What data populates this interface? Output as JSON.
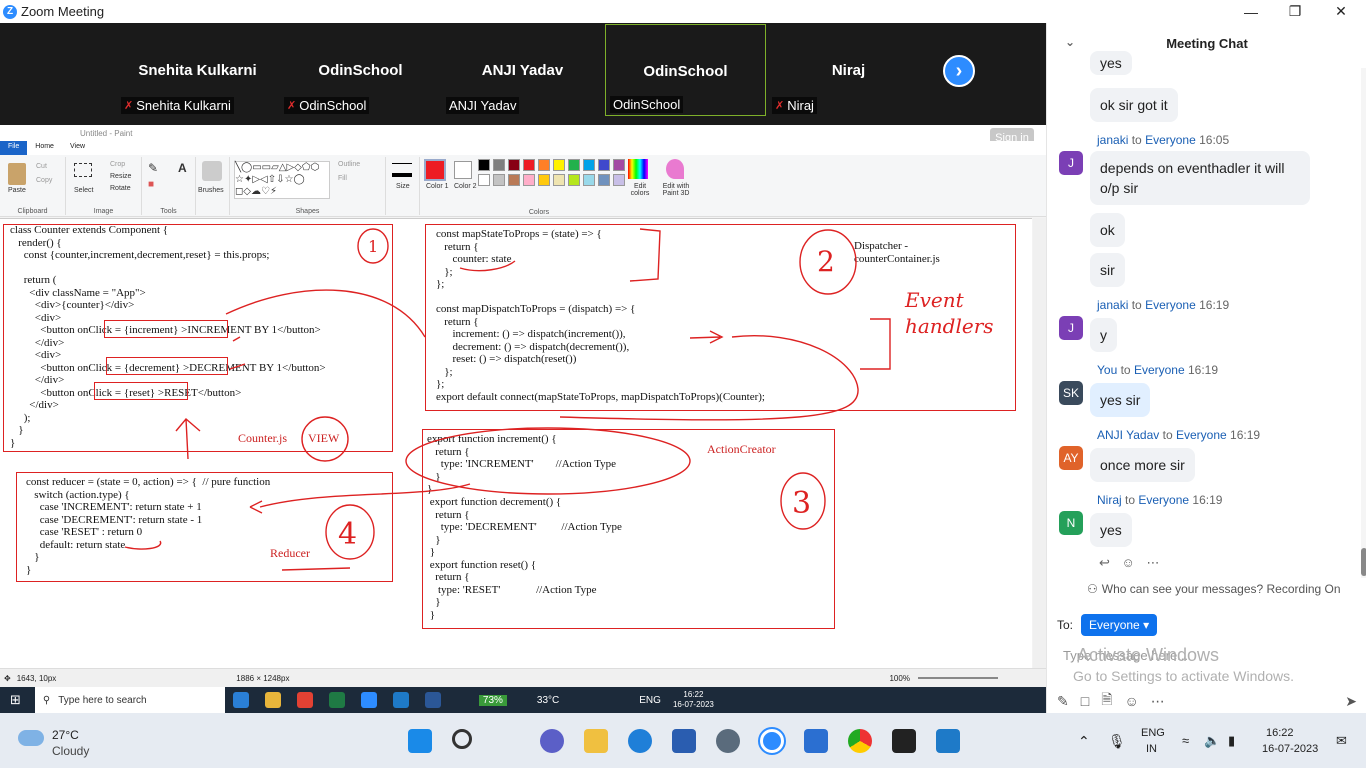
{
  "window": {
    "title": "Zoom Meeting",
    "minimize": "—",
    "maximize": "❐",
    "close": "✕"
  },
  "gallery": {
    "tiles": [
      {
        "name": "Snehita Kulkarni",
        "label": "Snehita Kulkarni",
        "muted": true,
        "active": false
      },
      {
        "name": "OdinSchool",
        "label": "OdinSchool",
        "muted": true,
        "active": false
      },
      {
        "name": "ANJI Yadav",
        "label": "ANJI Yadav",
        "muted": false,
        "active": false
      },
      {
        "name": "OdinSchool",
        "label": "OdinSchool",
        "muted": false,
        "active": true
      },
      {
        "name": "Niraj",
        "label": "Niraj",
        "muted": true,
        "active": false
      }
    ],
    "next_icon": "chevron-right-icon"
  },
  "paint": {
    "title": "Untitled - Paint",
    "signin": "Sign in",
    "tabs": [
      "File",
      "Home",
      "View"
    ],
    "groups": [
      "Clipboard",
      "Image",
      "Tools",
      "Brushes",
      "Shapes",
      "Size",
      "Colors"
    ],
    "clipboard": {
      "paste": "Paste",
      "cut": "Cut",
      "copy": "Copy"
    },
    "image": {
      "select": "Select",
      "crop": "Crop",
      "resize": "Resize",
      "rotate": "Rotate"
    },
    "shapes_extra": {
      "outline": "Outline",
      "fill": "Fill"
    },
    "color1": "Color 1",
    "color2": "Color 2",
    "edit_colors": "Edit colors",
    "edit_paint3d": "Edit with Paint 3D",
    "palette": [
      "#000000",
      "#7f7f7f",
      "#880015",
      "#ed1c24",
      "#ff7f27",
      "#fff200",
      "#22b14c",
      "#00a2e8",
      "#3f48cc",
      "#a349a4",
      "#ffffff",
      "#c3c3c3",
      "#b97a57",
      "#ffaec9",
      "#ffc90e",
      "#efe4b0",
      "#b5e61d",
      "#99d9ea",
      "#7092be",
      "#c8bfe7"
    ],
    "status": {
      "pos": "1643, 10px",
      "size": "1886 × 1248px",
      "zoom": "100%"
    },
    "code_counter": "class Counter extends Component {\n   render() {\n     const {counter,increment,decrement,reset} = this.props;\n\n     return (\n       <div className = \"App\">\n         <div>{counter}</div>\n         <div>\n           <button onClick = {increment} >INCREMENT BY 1</button>\n         </div>\n         <div>\n           <button onClick = {decrement} >DECREMENT BY 1</button>\n         </div>\n           <button onClick = {reset} >RESET</button>\n       </div>\n     );\n   }\n}",
    "code_reducer": "const reducer = (state = 0, action) => {  // pure function\n   switch (action.type) {\n     case 'INCREMENT': return state + 1\n     case 'DECREMENT': return state - 1\n     case 'RESET' : return 0\n     default: return state\n   }\n}",
    "code_container": "const mapStateToProps = (state) => {\n   return {\n      counter: state\n   };\n};\n\nconst mapDispatchToProps = (dispatch) => {\n   return {\n      increment: () => dispatch(increment()),\n      decrement: () => dispatch(decrement()),\n      reset: () => dispatch(reset())\n   };\n};\nexport default connect(mapStateToProps, mapDispatchToProps)(Counter);",
    "code_actions_1": "export function increment() {\n   return {\n     type: 'INCREMENT'        //Action Type\n   }\n}",
    "code_actions_2": " export function decrement() {\n   return {\n     type: 'DECREMENT'         //Action Type\n   }\n }\n export function reset() {\n   return {\n    type: 'RESET'             //Action Type\n   }\n }",
    "label_counter": "Counter.js",
    "label_view": "VIEW",
    "label_reducer": "Reducer",
    "label_dispatcher": "Dispatcher -\ncounterContainer.js",
    "label_action_creator": "ActionCreator",
    "hand_event": "Event\nhandlers",
    "hand_1": "1",
    "hand_2": "2",
    "hand_3": "3",
    "hand_4": "4"
  },
  "inner_taskbar": {
    "search": "Type here to search",
    "battery": "73%",
    "temp": "33°C",
    "lang": "ENG",
    "time": "16:22",
    "date": "16-07-2023"
  },
  "chat": {
    "title": "Meeting Chat",
    "messages": [
      {
        "text": "yes"
      },
      {
        "text": "ok sir got it"
      },
      {
        "sender": "janaki",
        "to": "Everyone",
        "time": "16:05",
        "avatar": "J",
        "color": "#7b3fb5",
        "text": "depends on eventhadler it will o/p sir"
      },
      {
        "text": "ok"
      },
      {
        "text": "sir"
      },
      {
        "sender": "janaki",
        "to": "Everyone",
        "time": "16:19",
        "avatar": "J",
        "color": "#7b3fb5",
        "text": "y"
      },
      {
        "sender": "You",
        "to": "Everyone",
        "time": "16:19",
        "avatar": "SK",
        "color": "#3a4a5c",
        "text": "yes sir"
      },
      {
        "sender": "ANJI Yadav",
        "to": "Everyone",
        "time": "16:19",
        "avatar": "AY",
        "color": "#e0632a",
        "text": "once more sir"
      },
      {
        "sender": "Niraj",
        "to": "Everyone",
        "time": "16:19",
        "avatar": "N",
        "color": "#24a05a",
        "text": "yes"
      }
    ],
    "word_to": "to",
    "who_see": "Who can see your messages? Recording On",
    "to_label": "To:",
    "to_value": "Everyone",
    "input_placeholder": "Type message here...",
    "activate_title": "Activate Windows",
    "activate_sub": "Go to Settings to activate Windows."
  },
  "taskbar": {
    "temp": "27°C",
    "weather": "Cloudy",
    "lang1": "ENG",
    "lang2": "IN",
    "time": "16:22",
    "date": "16-07-2023"
  }
}
